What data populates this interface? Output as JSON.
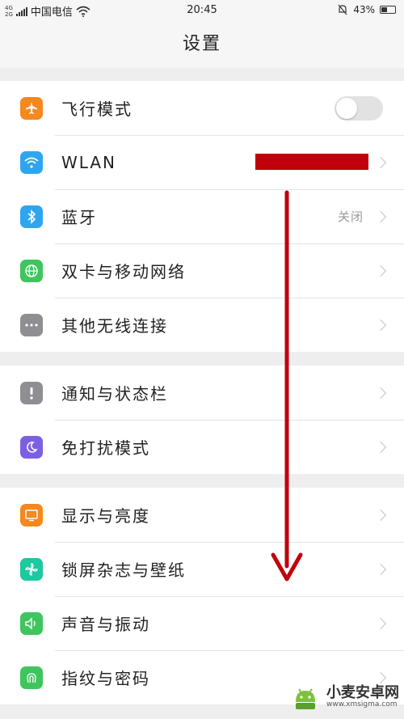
{
  "status_bar": {
    "network_top": "4G",
    "network_bottom": "2G",
    "carrier": "中国电信",
    "time": "20:45",
    "battery": "43%",
    "battery_level": 0.43
  },
  "header": {
    "title": "设置"
  },
  "groups": [
    [
      {
        "label": "飞行模式",
        "icon": "airplane-icon",
        "color": "#f5881f",
        "accessory": "toggle",
        "toggle_on": false
      },
      {
        "label": "WLAN",
        "icon": "wifi-icon",
        "color": "#2fa5f0",
        "accessory": "chevron",
        "value_redacted": true
      },
      {
        "label": "蓝牙",
        "icon": "bluetooth-icon",
        "color": "#2fa5f0",
        "accessory": "chevron",
        "value": "关闭"
      },
      {
        "label": "双卡与移动网络",
        "icon": "globe-icon",
        "color": "#3fc55e",
        "accessory": "chevron"
      },
      {
        "label": "其他无线连接",
        "icon": "more-icon",
        "color": "#8e8e93",
        "accessory": "chevron"
      }
    ],
    [
      {
        "label": "通知与状态栏",
        "icon": "notification-icon",
        "color": "#8e8e93",
        "accessory": "chevron"
      },
      {
        "label": "免打扰模式",
        "icon": "moon-icon",
        "color": "#7b61e0",
        "accessory": "chevron"
      }
    ],
    [
      {
        "label": "显示与亮度",
        "icon": "display-icon",
        "color": "#f5881f",
        "accessory": "chevron"
      },
      {
        "label": "锁屏杂志与壁纸",
        "icon": "pinwheel-icon",
        "color": "#1ec8a0",
        "accessory": "chevron"
      },
      {
        "label": "声音与振动",
        "icon": "speaker-icon",
        "color": "#3fc55e",
        "accessory": "chevron"
      },
      {
        "label": "指纹与密码",
        "icon": "fingerprint-icon",
        "color": "#3fc55e",
        "accessory": "chevron"
      }
    ]
  ],
  "annotation": {
    "arrow_color": "#c0000b",
    "redaction_color": "#c0000b"
  },
  "watermark": {
    "title": "小麦安卓网",
    "url": "www.xmsigma.com"
  }
}
